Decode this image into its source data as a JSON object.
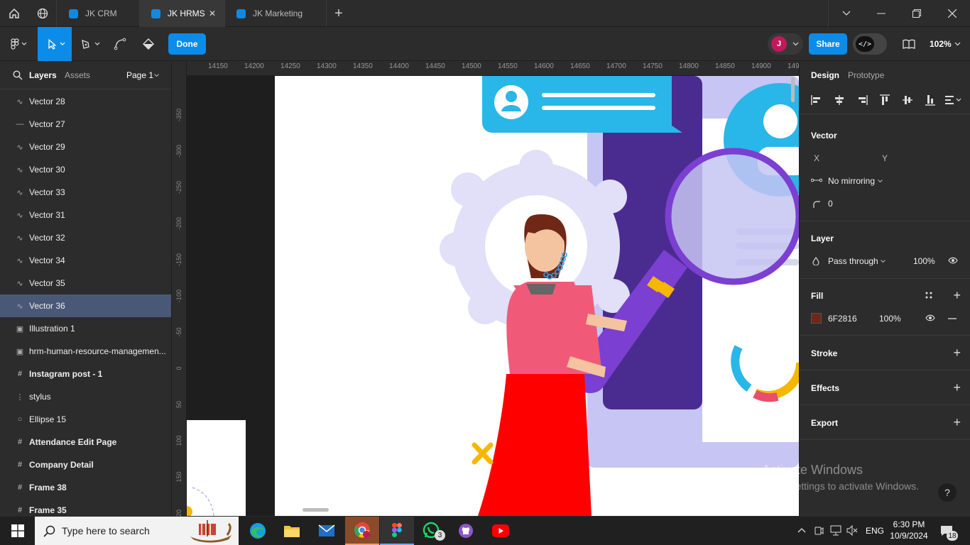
{
  "tabs": [
    {
      "label": "JK CRM",
      "active": false
    },
    {
      "label": "JK HRMS",
      "active": true
    },
    {
      "label": "JK Marketing",
      "active": false
    }
  ],
  "toolbar": {
    "done_label": "Done",
    "share_label": "Share",
    "avatar_initial": "J",
    "dev_mode_label": "</>",
    "zoom_label": "102%"
  },
  "left_panel": {
    "tabs": {
      "layers": "Layers",
      "assets": "Assets"
    },
    "page_label": "Page 1",
    "layers": [
      {
        "label": "Vector 28",
        "icon": "vector-icon",
        "selected": false,
        "bold": false
      },
      {
        "label": "Vector 27",
        "icon": "line-icon",
        "selected": false,
        "bold": false
      },
      {
        "label": "Vector 29",
        "icon": "vector-icon",
        "selected": false,
        "bold": false
      },
      {
        "label": "Vector 30",
        "icon": "vector-icon",
        "selected": false,
        "bold": false
      },
      {
        "label": "Vector 33",
        "icon": "vector-icon",
        "selected": false,
        "bold": false
      },
      {
        "label": "Vector 31",
        "icon": "vector-icon",
        "selected": false,
        "bold": false
      },
      {
        "label": "Vector 32",
        "icon": "vector-icon",
        "selected": false,
        "bold": false
      },
      {
        "label": "Vector 34",
        "icon": "vector-icon",
        "selected": false,
        "bold": false
      },
      {
        "label": "Vector 35",
        "icon": "vector-icon",
        "selected": false,
        "bold": false
      },
      {
        "label": "Vector 36",
        "icon": "vector-icon",
        "selected": true,
        "bold": false
      },
      {
        "label": "Illustration 1",
        "icon": "image-icon",
        "selected": false,
        "bold": false
      },
      {
        "label": "hrm-human-resource-managemen...",
        "icon": "image-icon",
        "selected": false,
        "bold": false
      },
      {
        "label": "Instagram post - 1",
        "icon": "frame-icon",
        "selected": false,
        "bold": true
      },
      {
        "label": "stylus",
        "icon": "section-icon",
        "selected": false,
        "bold": false
      },
      {
        "label": "Ellipse 15",
        "icon": "ellipse-icon",
        "selected": false,
        "bold": false
      },
      {
        "label": "Attendance Edit Page",
        "icon": "frame-icon",
        "selected": false,
        "bold": true
      },
      {
        "label": "Company Detail",
        "icon": "frame-icon",
        "selected": false,
        "bold": true
      },
      {
        "label": "Frame 38",
        "icon": "frame-icon",
        "selected": false,
        "bold": true
      },
      {
        "label": "Frame 35",
        "icon": "frame-icon",
        "selected": false,
        "bold": true
      }
    ]
  },
  "rulers": {
    "horizontal": [
      "14150",
      "14200",
      "14250",
      "14300",
      "14350",
      "14400",
      "14450",
      "14500",
      "14550",
      "14600",
      "14650",
      "14700",
      "14750",
      "14800",
      "14850",
      "14900",
      "149"
    ],
    "vertical": [
      "-350",
      "-300",
      "-250",
      "-200",
      "-150",
      "-100",
      "-50",
      "0",
      "50",
      "100",
      "150",
      "20"
    ]
  },
  "right_panel": {
    "tabs": {
      "design": "Design",
      "prototype": "Prototype"
    },
    "vector": {
      "title": "Vector",
      "x_label": "X",
      "y_label": "Y",
      "mirroring": "No mirroring",
      "corner_radius": "0"
    },
    "layer": {
      "title": "Layer",
      "blend_mode": "Pass through",
      "opacity": "100%"
    },
    "fill": {
      "title": "Fill",
      "color_hex": "6F2816",
      "swatch_color": "#6f2816",
      "opacity": "100%"
    },
    "stroke": {
      "title": "Stroke"
    },
    "effects": {
      "title": "Effects"
    },
    "export": {
      "title": "Export"
    }
  },
  "watermark": {
    "line1": "Activate Windows",
    "line2": "Go to Settings to activate Windows."
  },
  "taskbar": {
    "search_placeholder": "Type here to search",
    "whatsapp_badge": "3",
    "time": "6:30 PM",
    "date": "10/9/2024",
    "language": "ENG",
    "notification_count": "18"
  },
  "colors": {
    "accent": "#0c8ce9",
    "selection": "#4a5878",
    "panel_bg": "#2c2c2c",
    "canvas_bg": "#1e1e1e"
  }
}
